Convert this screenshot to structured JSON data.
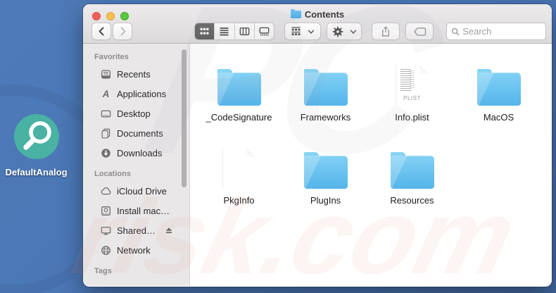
{
  "desktop": {
    "icon": {
      "label": "DefaultAnalog",
      "glyph": "magnifier-icon",
      "color": "#49b2a2"
    }
  },
  "watermark": {
    "text_top": "PC",
    "text_bottom": "risk.com"
  },
  "window": {
    "title": "Contents",
    "traffic_lights": [
      "close",
      "minimize",
      "zoom"
    ],
    "toolbar": {
      "back": "Back",
      "forward": "Forward",
      "views": [
        "icon",
        "list",
        "column",
        "gallery"
      ],
      "selected_view": "icon",
      "group_button": "Group items",
      "action_button": "Action",
      "share_button": "Share",
      "tag_button": "Edit Tags",
      "search": {
        "placeholder": "Search"
      }
    },
    "sidebar": {
      "sections": [
        {
          "title": "Favorites",
          "items": [
            {
              "label": "Recents",
              "icon": "recents-icon"
            },
            {
              "label": "Applications",
              "icon": "applications-icon"
            },
            {
              "label": "Desktop",
              "icon": "desktop-icon"
            },
            {
              "label": "Documents",
              "icon": "documents-icon"
            },
            {
              "label": "Downloads",
              "icon": "downloads-icon"
            }
          ]
        },
        {
          "title": "Locations",
          "items": [
            {
              "label": "iCloud Drive",
              "icon": "cloud-icon"
            },
            {
              "label": "Install mac…",
              "icon": "disk-icon"
            },
            {
              "label": "Shared…",
              "icon": "display-icon",
              "eject": true
            },
            {
              "label": "Network",
              "icon": "globe-icon"
            }
          ]
        },
        {
          "title": "Tags",
          "items": []
        }
      ]
    },
    "files": [
      {
        "name": "_CodeSignature",
        "type": "folder"
      },
      {
        "name": "Frameworks",
        "type": "folder"
      },
      {
        "name": "Info.plist",
        "type": "plist-document"
      },
      {
        "name": "MacOS",
        "type": "folder"
      },
      {
        "name": "PkgInfo",
        "type": "blank-document"
      },
      {
        "name": "PlugIns",
        "type": "folder"
      },
      {
        "name": "Resources",
        "type": "folder"
      }
    ],
    "plist_badge": "PLIST"
  },
  "colors": {
    "desktop_blue": "#4a76b4",
    "folder_blue_top": "#83d1f4",
    "folder_blue_bottom": "#55b4e9",
    "icon_teal": "#49b2a2",
    "selected_segment": "#5c5c5c",
    "sidebar_bg": "#e9e7e8"
  }
}
